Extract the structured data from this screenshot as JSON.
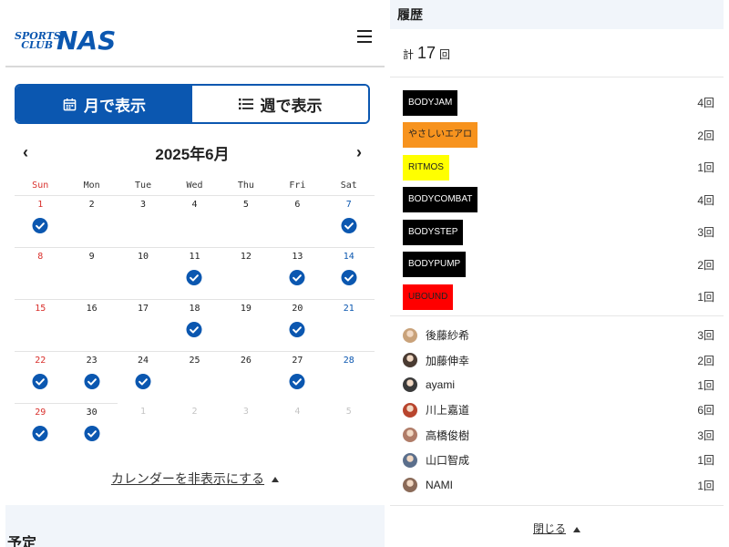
{
  "header": {
    "logo_small": "SPORTS CLUB",
    "logo_big": "NAS"
  },
  "view_toggle": {
    "month_label": "月で表示",
    "week_label": "週で表示",
    "active": "month",
    "accent": "#0b57b0"
  },
  "calendar": {
    "month_title": "2025年6月",
    "prev_icon": "chevron-left-icon",
    "next_icon": "chevron-right-icon",
    "weekdays": [
      "Sun",
      "Mon",
      "Tue",
      "Wed",
      "Thu",
      "Fri",
      "Sat"
    ],
    "weeks": [
      [
        {
          "d": "1",
          "c": true
        },
        {
          "d": "2"
        },
        {
          "d": "3"
        },
        {
          "d": "4"
        },
        {
          "d": "5"
        },
        {
          "d": "6"
        },
        {
          "d": "7",
          "c": true
        }
      ],
      [
        {
          "d": "8"
        },
        {
          "d": "9"
        },
        {
          "d": "10"
        },
        {
          "d": "11",
          "c": true
        },
        {
          "d": "12"
        },
        {
          "d": "13",
          "c": true
        },
        {
          "d": "14",
          "c": true
        }
      ],
      [
        {
          "d": "15"
        },
        {
          "d": "16"
        },
        {
          "d": "17"
        },
        {
          "d": "18",
          "c": true
        },
        {
          "d": "19"
        },
        {
          "d": "20",
          "c": true
        },
        {
          "d": "21"
        }
      ],
      [
        {
          "d": "22",
          "c": true
        },
        {
          "d": "23",
          "c": true
        },
        {
          "d": "24",
          "c": true
        },
        {
          "d": "25"
        },
        {
          "d": "26"
        },
        {
          "d": "27",
          "c": true
        },
        {
          "d": "28"
        }
      ],
      [
        {
          "d": "29",
          "c": true
        },
        {
          "d": "30",
          "c": true
        },
        {
          "d": "1",
          "m": true
        },
        {
          "d": "2",
          "m": true
        },
        {
          "d": "3",
          "m": true
        },
        {
          "d": "4",
          "m": true
        },
        {
          "d": "5",
          "m": true
        }
      ]
    ],
    "hide_label": "カレンダーを非表示にする"
  },
  "schedule": {
    "title": "予定"
  },
  "history": {
    "title": "履歴",
    "total_prefix": "計",
    "total_value": "17",
    "total_suffix": "回",
    "programs": [
      {
        "name": "BODYJAM",
        "count": "4回",
        "bg": "#000000",
        "fg": "#ffffff"
      },
      {
        "name": "やさしいエアロ",
        "count": "2回",
        "bg": "#f7931e",
        "fg": "#222222"
      },
      {
        "name": "RITMOS",
        "count": "1回",
        "bg": "#ffff00",
        "fg": "#222222"
      },
      {
        "name": "BODYCOMBAT",
        "count": "4回",
        "bg": "#000000",
        "fg": "#ffffff"
      },
      {
        "name": "BODYSTEP",
        "count": "3回",
        "bg": "#000000",
        "fg": "#ffffff"
      },
      {
        "name": "BODYPUMP",
        "count": "2回",
        "bg": "#000000",
        "fg": "#ffffff"
      },
      {
        "name": "UBOUND",
        "count": "1回",
        "bg": "#ff0000",
        "fg": "#222222"
      }
    ],
    "instructors": [
      {
        "name": "後藤紗希",
        "count": "3回",
        "color": "#c9a27a"
      },
      {
        "name": "加藤伸幸",
        "count": "2回",
        "color": "#4a3b32"
      },
      {
        "name": "ayami",
        "count": "1回",
        "color": "#3a3a3a"
      },
      {
        "name": "川上嘉道",
        "count": "6回",
        "color": "#b8452e"
      },
      {
        "name": "高橋俊樹",
        "count": "3回",
        "color": "#b07c68"
      },
      {
        "name": "山口智成",
        "count": "1回",
        "color": "#5b6f8c"
      },
      {
        "name": "NAMI",
        "count": "1回",
        "color": "#8a6a58"
      }
    ],
    "close_label": "閉じる"
  }
}
